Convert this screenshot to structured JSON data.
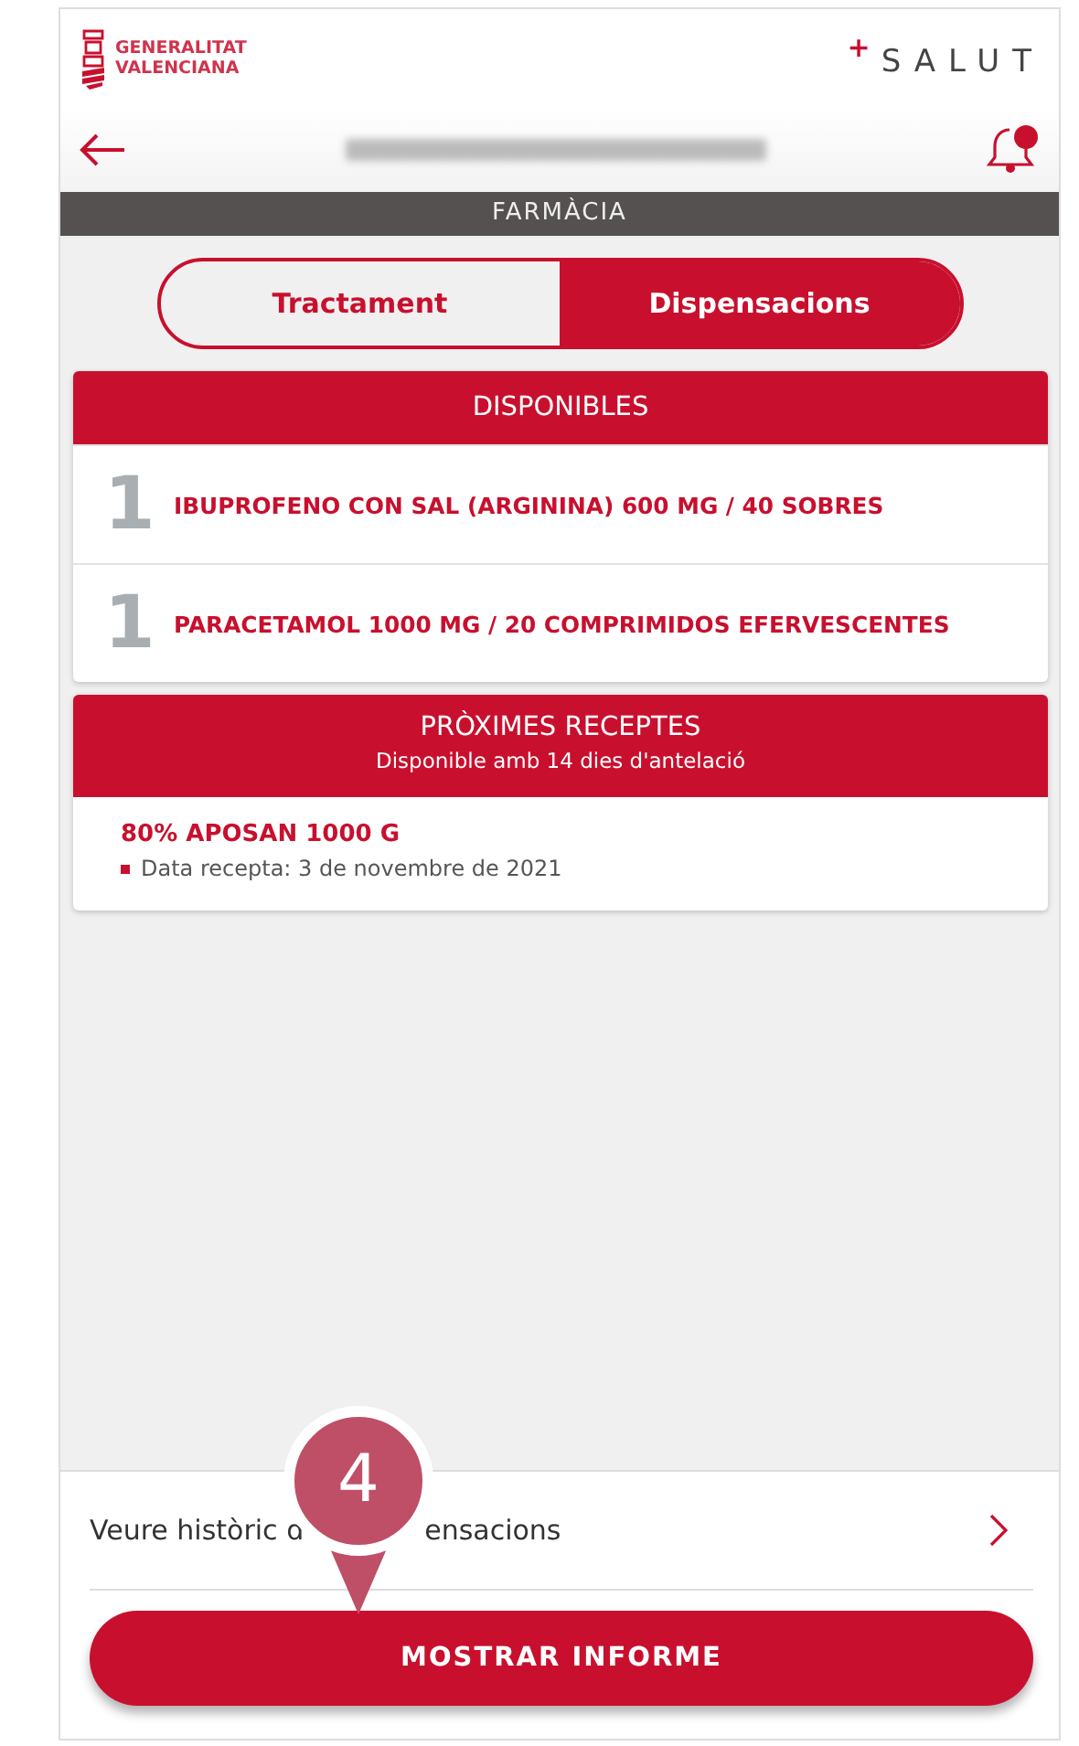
{
  "header": {
    "logo_text": [
      "GENERALITAT",
      "VALENCIANA"
    ],
    "brand_mark": "+",
    "brand": "SALUT",
    "notifications_unread": true
  },
  "section_bar": "FARMÀCIA",
  "tabs": [
    {
      "label": "Tractament",
      "selected": false
    },
    {
      "label": "Dispensacions",
      "selected": true
    }
  ],
  "available": {
    "title": "DISPONIBLES",
    "items": [
      {
        "quantity": "1",
        "name": "IBUPROFENO CON SAL (ARGININA) 600 MG / 40 SOBRES"
      },
      {
        "quantity": "1",
        "name": "PARACETAMOL 1000 MG / 20 COMPRIMIDOS EFERVESCENTES"
      }
    ]
  },
  "upcoming": {
    "title": "PRÒXIMES RECEPTES",
    "subtitle": "Disponible amb 14 dies d'antelació",
    "items": [
      {
        "name": "80% APOSAN 1000 G",
        "detail": "Data recepta: 3 de novembre de 2021"
      }
    ]
  },
  "history_link": {
    "text_before": "Veure històric d",
    "text_after": "ensacions"
  },
  "callout": {
    "number": "4"
  },
  "report_button": "MOSTRAR INFORME"
}
